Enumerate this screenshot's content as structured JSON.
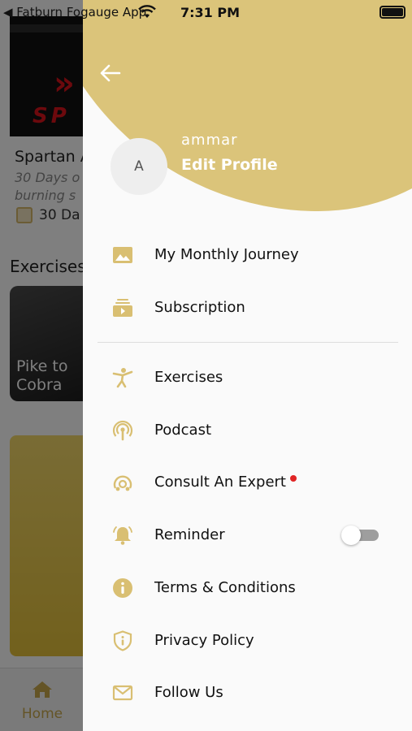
{
  "status_bar": {
    "back_app": "◀ Fatburn Fogauge App",
    "time": "7:31 PM"
  },
  "background": {
    "program_title": "Spartan A",
    "program_subtitle_1": "30 Days o",
    "program_subtitle_2": "burning s",
    "program_days": "30 Da",
    "exercises_heading": "Exercises",
    "exercise_card_label": "Pike to Cobra",
    "tab_home_label": "Home",
    "card_logo_text": "SP"
  },
  "profile": {
    "avatar_initial": "A",
    "name": "ammar",
    "edit_label": "Edit Profile"
  },
  "menu": {
    "monthly_journey": "My Monthly Journey",
    "subscription": "Subscription",
    "exercises": "Exercises",
    "podcast": "Podcast",
    "consult_expert": "Consult An Expert",
    "reminder": "Reminder",
    "terms": "Terms & Conditions",
    "privacy": "Privacy Policy",
    "follow_us": "Follow Us"
  },
  "reminder_toggle": {
    "on": false
  },
  "icons": {
    "monthly_journey": "image-icon",
    "subscription": "subscription-icon",
    "exercises": "exercise-figure-icon",
    "podcast": "podcast-icon",
    "consult_expert": "expert-icon",
    "reminder": "bell-icon",
    "terms": "info-icon",
    "privacy": "shield-info-icon",
    "follow_us": "mail-icon"
  },
  "colors": {
    "accent": "#dbc47a",
    "icon": "#d9bf72",
    "notification_dot": "#e02424"
  }
}
